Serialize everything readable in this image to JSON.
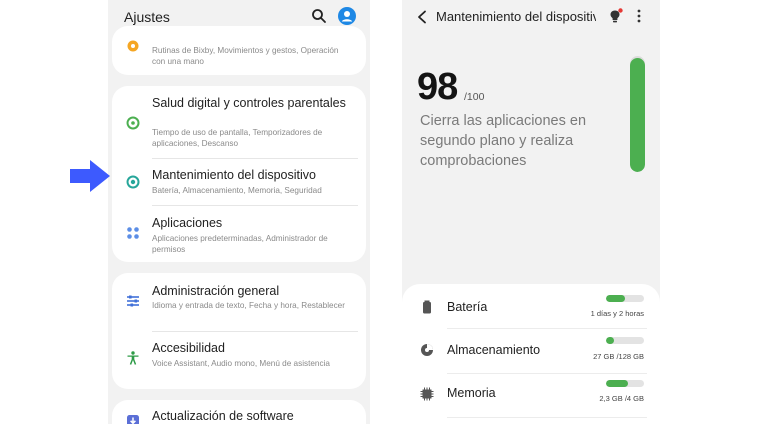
{
  "colors": {
    "accent": "#1e88e5",
    "green": "#4caf50",
    "pointer_arrow": "#3d5afe"
  },
  "settings": {
    "title": "Ajustes",
    "icons": {
      "search": "search-icon",
      "profile": "profile-icon"
    },
    "items": [
      {
        "title": "",
        "subtitle": "Rutinas de Bixby, Movimientos y gestos, Operación con una mano",
        "icon": "advanced-features-icon",
        "icon_color": "#f5a623"
      },
      {
        "title": "Salud digital y controles parentales",
        "subtitle": "Tiempo de uso de pantalla, Temporizadores de aplicaciones, Descanso",
        "icon": "digital-wellbeing-icon",
        "icon_color": "#4caf50"
      },
      {
        "title": "Mantenimiento del dispositivo",
        "subtitle": "Batería, Almacenamiento, Memoria, Seguridad",
        "icon": "device-care-icon",
        "icon_color": "#26a69a"
      },
      {
        "title": "Aplicaciones",
        "subtitle": "Aplicaciones predeterminadas, Administrador de permisos",
        "icon": "apps-icon",
        "icon_color": "#5c8ee6"
      },
      {
        "title": "Administración general",
        "subtitle": "Idioma y entrada de texto, Fecha y hora, Restablecer",
        "icon": "general-management-icon",
        "icon_color": "#3f6fd8"
      },
      {
        "title": "Accesibilidad",
        "subtitle": "Voice Assistant, Audio mono, Menú de asistencia",
        "icon": "accessibility-icon",
        "icon_color": "#2e9b47"
      },
      {
        "title": "Actualización de software",
        "subtitle": "",
        "icon": "software-update-icon",
        "icon_color": "#5b6fd6"
      }
    ]
  },
  "device_care": {
    "title": "Mantenimiento del dispositivo",
    "icons": {
      "back": "back-arrow-icon",
      "tip": "tip-lightbulb-icon",
      "more": "more-options-icon"
    },
    "score": "98",
    "score_max": "/100",
    "score_fraction": 0.98,
    "description": "Cierra las aplicaciones en segundo plano y realiza comprobaciones",
    "status": [
      {
        "label": "Batería",
        "value": "1 días y 2 horas",
        "fill": 0.5,
        "icon": "battery-icon"
      },
      {
        "label": "Almacenamiento",
        "value": "27 GB /128 GB",
        "fill": 0.21,
        "icon": "storage-icon"
      },
      {
        "label": "Memoria",
        "value": "2,3 GB /4 GB",
        "fill": 0.58,
        "icon": "memory-icon"
      }
    ]
  }
}
